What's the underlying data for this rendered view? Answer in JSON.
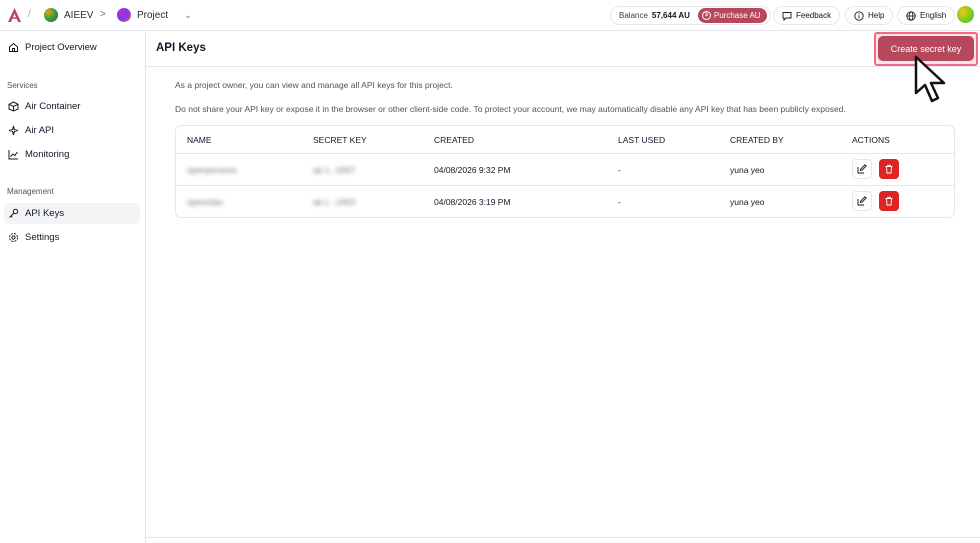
{
  "breadcrumb": {
    "sep": "/",
    "org": "AIEEV",
    "arrow": ">",
    "project": "Project"
  },
  "topbar": {
    "balance_label": "Balance",
    "balance_value": "57,644 AU",
    "purchase_label": "Purchase AU",
    "feedback_label": "Feedback",
    "help_label": "Help",
    "language_label": "English"
  },
  "sidebar": {
    "overview": "Project Overview",
    "services_label": "Services",
    "services": [
      "Air Container",
      "Air API",
      "Monitoring"
    ],
    "management_label": "Management",
    "management": [
      "API Keys",
      "Settings"
    ]
  },
  "main": {
    "title": "API Keys",
    "create_button": "Create secret key",
    "desc1": "As a project owner, you can view and manage all API keys for this project.",
    "desc2": "Do not share your API key or expose it in the browser or other client-side code. To protect your account, we may automatically disable any API key that has been publicly exposed."
  },
  "table": {
    "headers": [
      "NAME",
      "SECRET KEY",
      "CREATED",
      "LAST USED",
      "CREATED BY",
      "ACTIONS"
    ],
    "rows": [
      {
        "name": "openpersona",
        "key": "ak-1...6307",
        "created": "04/08/2026 9:32 PM",
        "last_used": "-",
        "created_by": "yuna yeo"
      },
      {
        "name": "openclaw",
        "key": "ak-c...2463",
        "created": "04/08/2026 3:19 PM",
        "last_used": "-",
        "created_by": "yuna yeo"
      }
    ]
  },
  "colors": {
    "accent": "#b5495b",
    "danger": "#dc2626",
    "highlight": "#f06b86"
  }
}
